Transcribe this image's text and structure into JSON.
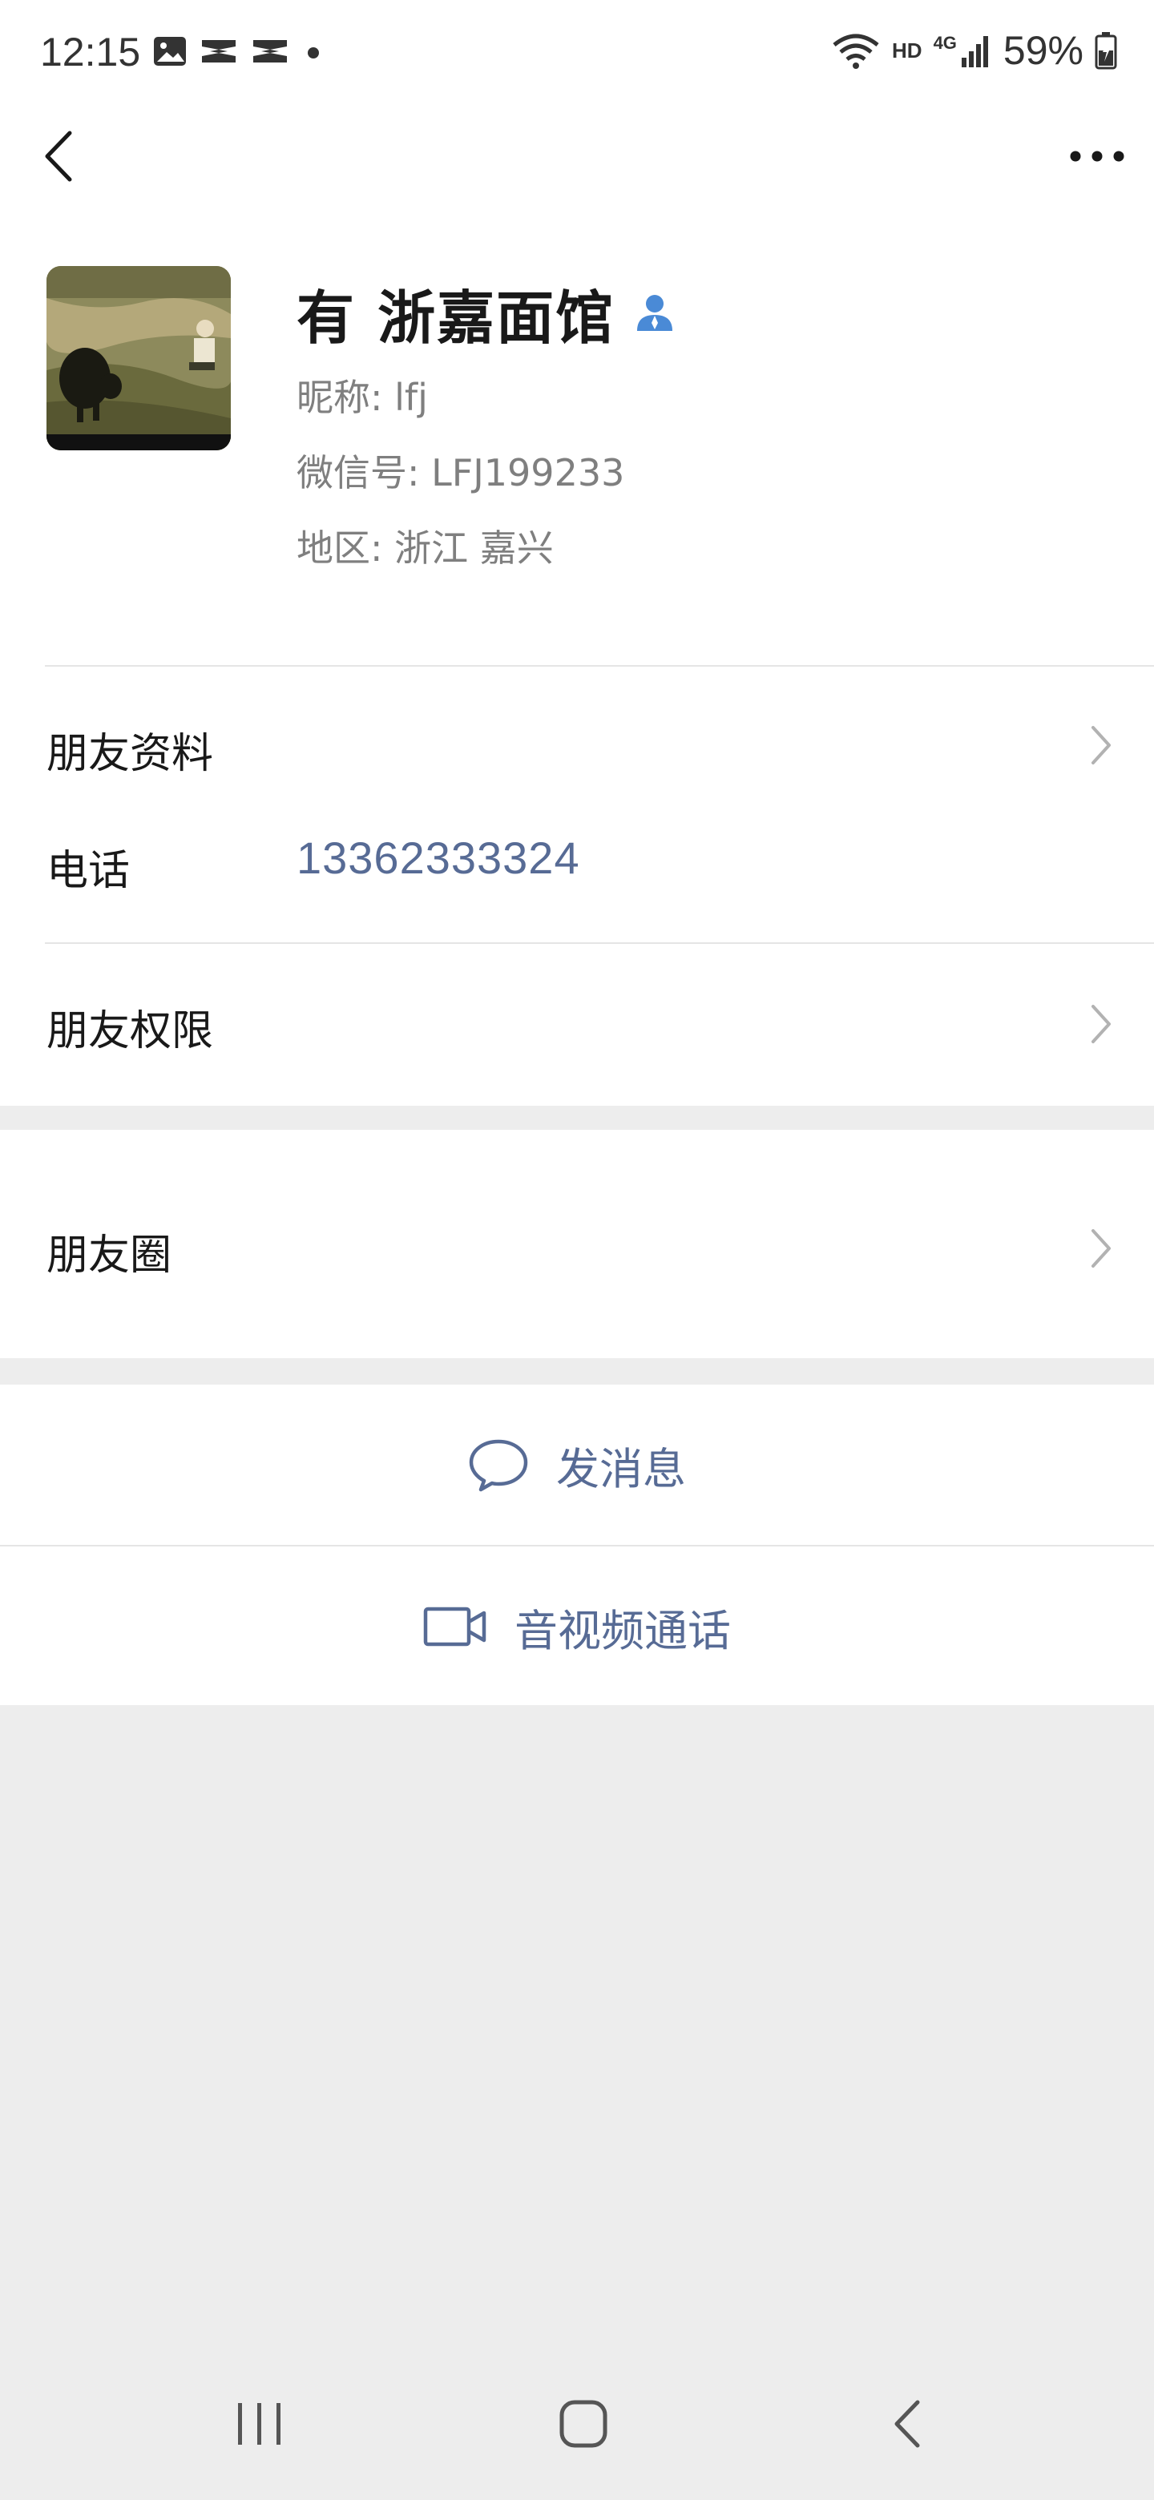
{
  "status_bar": {
    "time": "12:15",
    "network": "HD",
    "signal_label": "4G",
    "battery": "59%"
  },
  "nav": {
    "back_icon": "chevron-left-icon",
    "more_icon": "more-horizontal-icon"
  },
  "profile": {
    "name": "有 浙嘉面馆",
    "nickname_label": "昵称: ",
    "nickname": "lfj",
    "wechat_id_label": "微信号: ",
    "wechat_id": "LFJ199233",
    "region_label": "地区: ",
    "region": "浙江  嘉兴"
  },
  "rows": {
    "friend_info": "朋友资料",
    "phone_label": "电话",
    "phone_value": "13362333324",
    "friend_permissions": "朋友权限",
    "moments": "朋友圈"
  },
  "actions": {
    "message": "发消息",
    "video_call": "音视频通话"
  },
  "colors": {
    "link": "#576b95",
    "background": "#ededed",
    "card": "#ffffff",
    "verified_icon": "#4a8ad6"
  }
}
